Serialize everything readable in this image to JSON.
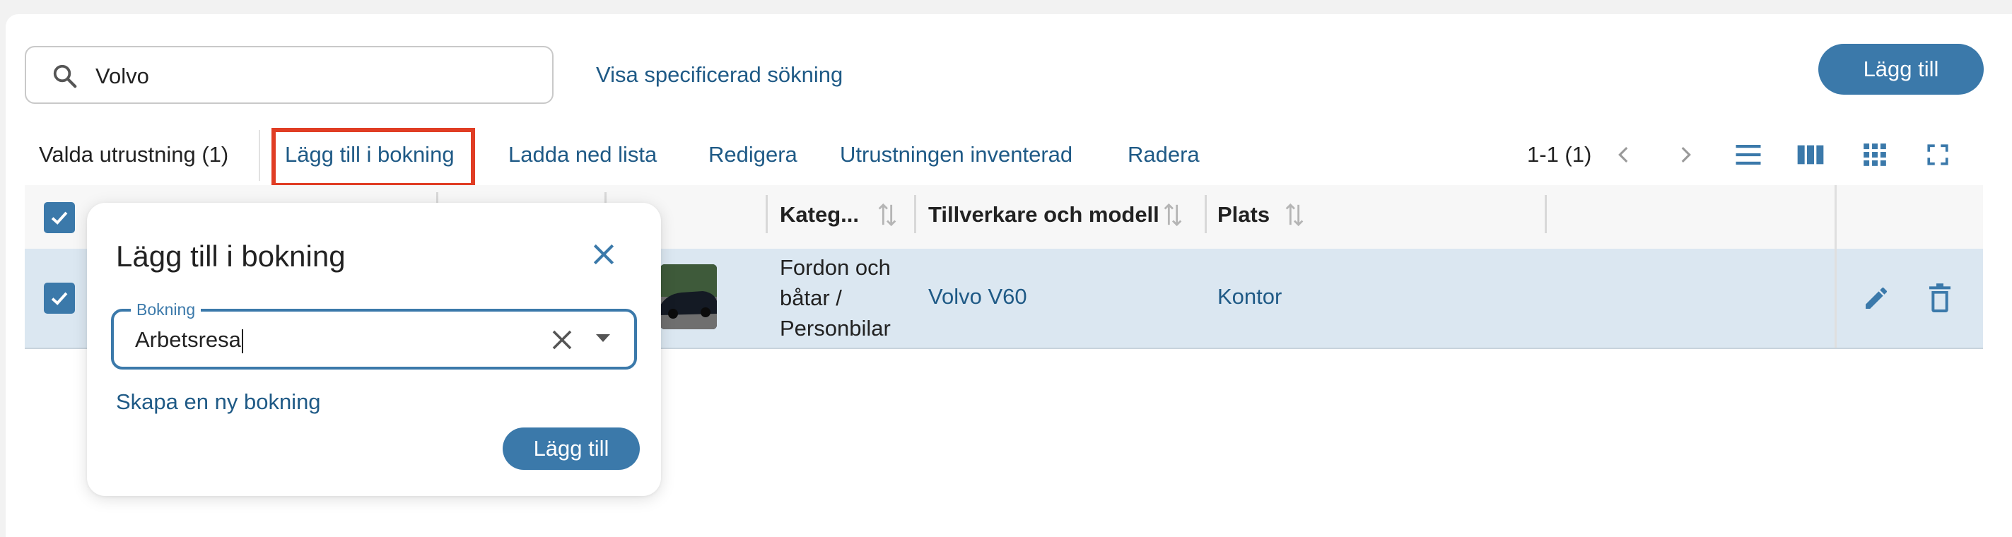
{
  "search": {
    "value": "Volvo"
  },
  "header": {
    "advanced_search_link": "Visa specificerad sökning",
    "add_button": "Lägg till"
  },
  "toolbar": {
    "selected_label": "Valda utrustning (1)",
    "actions": [
      "Lägg till i bokning",
      "Ladda ned lista",
      "Redigera",
      "Utrustningen inventerad",
      "Radera"
    ],
    "pagination": "1-1 (1)"
  },
  "table": {
    "columns": [
      "Kateg...",
      "Tillverkare och modell",
      "Plats"
    ],
    "rows": [
      {
        "category_lines": [
          "Fordon och",
          "båtar /",
          "Personbilar"
        ],
        "model": "Volvo V60",
        "location": "Kontor"
      }
    ]
  },
  "popover": {
    "title": "Lägg till i bokning",
    "field_label": "Bokning",
    "field_value": "Arbetsresa",
    "create_link": "Skapa en ny bokning",
    "submit_button": "Lägg till"
  },
  "colors": {
    "accent": "#3b79aa",
    "link": "#1f5a86",
    "highlight": "#e03d24",
    "row_selected": "#dbe7f1"
  },
  "icons": [
    "search-icon",
    "chevron-left-icon",
    "chevron-right-icon",
    "list-view-icon",
    "column-view-icon",
    "grid-view-icon",
    "fullscreen-icon",
    "sort-icon",
    "check-icon",
    "edit-icon",
    "delete-icon",
    "close-icon",
    "clear-icon",
    "dropdown-arrow-icon"
  ]
}
